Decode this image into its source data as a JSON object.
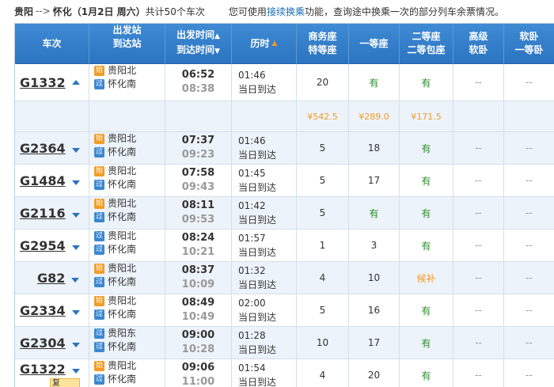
{
  "header": {
    "from": "贵阳",
    "arrow": "-->",
    "to": "怀化",
    "date_part": "（1月2日  周六）",
    "count_text": "共计50个车次",
    "tip_before": "您可使用",
    "tip_link": "接续换乘",
    "tip_after": "功能，查询途中换乘一次的部分列车余票情况。"
  },
  "columns": {
    "train": "车次",
    "stations_top": "出发站",
    "stations_bottom": "到达站",
    "time_top": "出发时间",
    "time_bottom": "到达时间",
    "duration": "历时",
    "business_top": "商务座",
    "business_bottom": "特等座",
    "first": "一等座",
    "second_top": "二等座",
    "second_bottom": "二等包座",
    "premium_top": "高级",
    "premium_bottom": "软卧",
    "soft_top": "软卧",
    "soft_bottom": "一等卧"
  },
  "trains": [
    {
      "no": "G1332",
      "from_badge": "始",
      "from": "贵阳北",
      "to_badge": "过",
      "to": "怀化南",
      "dep": "06:52",
      "arr": "08:38",
      "dur": "01:46",
      "day": "当日到达",
      "business": "20",
      "first": "有",
      "second": "有",
      "premium": "--",
      "soft": "--"
    },
    {
      "no": "G2364",
      "from_badge": "始",
      "from": "贵阳北",
      "to_badge": "过",
      "to": "怀化南",
      "dep": "07:37",
      "arr": "09:23",
      "dur": "01:46",
      "day": "当日到达",
      "business": "5",
      "first": "18",
      "second": "有",
      "premium": "--",
      "soft": "--"
    },
    {
      "no": "G1484",
      "from_badge": "始",
      "from": "贵阳北",
      "to_badge": "过",
      "to": "怀化南",
      "dep": "07:58",
      "arr": "09:43",
      "dur": "01:45",
      "day": "当日到达",
      "business": "5",
      "first": "17",
      "second": "有",
      "premium": "--",
      "soft": "--"
    },
    {
      "no": "G2116",
      "from_badge": "始",
      "from": "贵阳北",
      "to_badge": "过",
      "to": "怀化南",
      "dep": "08:11",
      "arr": "09:53",
      "dur": "01:42",
      "day": "当日到达",
      "business": "5",
      "first": "有",
      "second": "有",
      "premium": "--",
      "soft": "--"
    },
    {
      "no": "G2954",
      "from_badge": "过",
      "from": "贵阳北",
      "to_badge": "过",
      "to": "怀化南",
      "dep": "08:24",
      "arr": "10:21",
      "dur": "01:57",
      "day": "当日到达",
      "business": "1",
      "first": "3",
      "second": "有",
      "premium": "--",
      "soft": "--"
    },
    {
      "no": "G82",
      "from_badge": "始",
      "from": "贵阳北",
      "to_badge": "过",
      "to": "怀化南",
      "dep": "08:37",
      "arr": "10:09",
      "dur": "01:32",
      "day": "当日到达",
      "business": "4",
      "first": "10",
      "second": "候补",
      "premium": "--",
      "soft": "--"
    },
    {
      "no": "G2334",
      "from_badge": "始",
      "from": "贵阳北",
      "to_badge": "过",
      "to": "怀化南",
      "dep": "08:49",
      "arr": "10:49",
      "dur": "02:00",
      "day": "当日到达",
      "business": "5",
      "first": "16",
      "second": "有",
      "premium": "--",
      "soft": "--"
    },
    {
      "no": "G2304",
      "from_badge": "过",
      "from": "贵阳东",
      "to_badge": "过",
      "to": "怀化南",
      "dep": "09:00",
      "arr": "10:28",
      "dur": "01:28",
      "day": "当日到达",
      "business": "10",
      "first": "17",
      "second": "有",
      "premium": "--",
      "soft": "--"
    },
    {
      "no": "G1322",
      "badge_extra": "复",
      "from_badge": "始",
      "from": "贵阳北",
      "to_badge": "过",
      "to": "怀化南",
      "dep": "09:06",
      "arr": "11:00",
      "dur": "01:54",
      "day": "当日到达",
      "business": "4",
      "first": "20",
      "second": "有",
      "premium": "--",
      "soft": "--"
    }
  ],
  "prices": {
    "business": "¥542.5",
    "first": "¥289.0",
    "second": "¥171.5"
  },
  "colors": {
    "header_blue": "#2b73c0",
    "available_green": "#2a8c2a",
    "price_orange": "#f39b26",
    "link_blue": "#1a6eb6"
  }
}
